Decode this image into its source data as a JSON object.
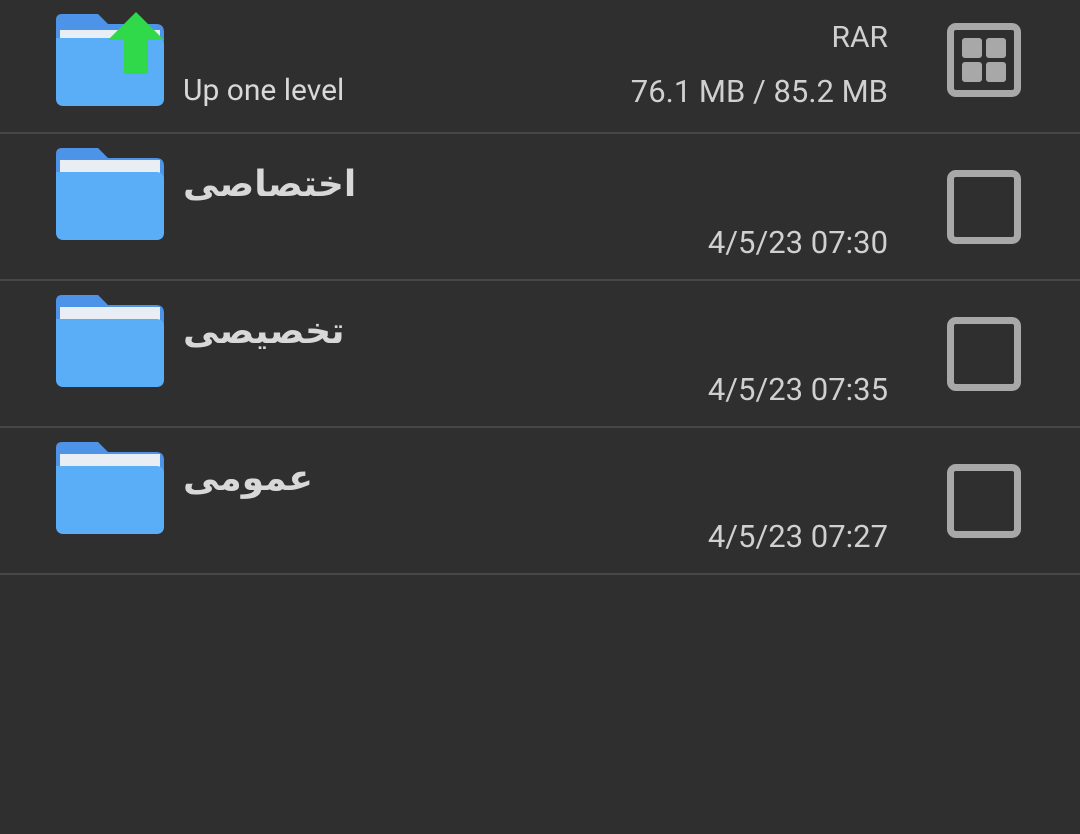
{
  "colors": {
    "background": "#2f2f2f",
    "divider": "#474747",
    "folder_blue": "#5aaef7",
    "folder_tab": "#4d93e8",
    "arrow_green": "#2fd94a",
    "text": "#d8d8d8",
    "checkbox": "#a8a8a8"
  },
  "up_row": {
    "label": "Up one level",
    "archive_type": "RAR",
    "size": "76.1 MB / 85.2 MB",
    "icon": "folder-up-icon",
    "action_icon": "grid-select-icon"
  },
  "items": [
    {
      "name": "اختصاصی",
      "date": "4/5/23 07:30",
      "icon": "folder-icon",
      "checked": false
    },
    {
      "name": "تخصیصی",
      "date": "4/5/23 07:35",
      "icon": "folder-icon",
      "checked": false
    },
    {
      "name": "عمومی",
      "date": "4/5/23 07:27",
      "icon": "folder-icon",
      "checked": false
    }
  ]
}
